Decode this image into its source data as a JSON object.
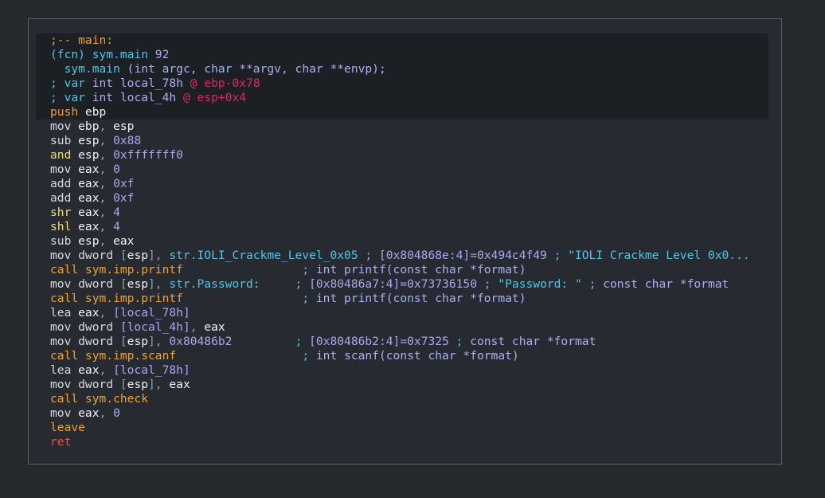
{
  "lines": [
    [
      [
        "c-label",
        ";-- main:"
      ]
    ],
    [
      [
        "c-fcn",
        "(fcn) sym.main"
      ],
      [
        "c-num",
        " 92"
      ]
    ],
    [
      [
        "c-default",
        "  "
      ],
      [
        "c-fcn",
        "sym.main"
      ],
      [
        "c-sig",
        " (int argc, char **argv, char **envp);"
      ]
    ],
    [
      [
        "c-comment",
        "; "
      ],
      [
        "c-comment",
        "var"
      ],
      [
        "c-var",
        " int local_78h "
      ],
      [
        "c-at",
        "@"
      ],
      [
        "c-stack",
        " ebp-0x78"
      ]
    ],
    [
      [
        "c-comment",
        "; "
      ],
      [
        "c-comment",
        "var"
      ],
      [
        "c-var",
        " int local_4h "
      ],
      [
        "c-at",
        "@"
      ],
      [
        "c-stack",
        " esp+0x4"
      ]
    ],
    [
      [
        "c-push",
        "push"
      ],
      [
        "c-reg",
        " ebp"
      ]
    ],
    [
      [
        "c-mov",
        "mov"
      ],
      [
        "c-reg",
        " ebp"
      ],
      [
        "c-punct",
        ","
      ],
      [
        "c-reg",
        " esp"
      ]
    ],
    [
      [
        "c-mov",
        "sub"
      ],
      [
        "c-reg",
        " esp"
      ],
      [
        "c-punct",
        ","
      ],
      [
        "c-num",
        " 0x88"
      ]
    ],
    [
      [
        "c-and",
        "and"
      ],
      [
        "c-reg",
        " esp"
      ],
      [
        "c-punct",
        ","
      ],
      [
        "c-num",
        " 0xfffffff0"
      ]
    ],
    [
      [
        "c-mov",
        "mov"
      ],
      [
        "c-reg",
        " eax"
      ],
      [
        "c-punct",
        ","
      ],
      [
        "c-num",
        " 0"
      ]
    ],
    [
      [
        "c-mov",
        "add"
      ],
      [
        "c-reg",
        " eax"
      ],
      [
        "c-punct",
        ","
      ],
      [
        "c-num",
        " 0xf"
      ]
    ],
    [
      [
        "c-mov",
        "add"
      ],
      [
        "c-reg",
        " eax"
      ],
      [
        "c-punct",
        ","
      ],
      [
        "c-num",
        " 0xf"
      ]
    ],
    [
      [
        "c-shift",
        "shr"
      ],
      [
        "c-reg",
        " eax"
      ],
      [
        "c-punct",
        ","
      ],
      [
        "c-num",
        " 4"
      ]
    ],
    [
      [
        "c-shift",
        "shl"
      ],
      [
        "c-reg",
        " eax"
      ],
      [
        "c-punct",
        ","
      ],
      [
        "c-num",
        " 4"
      ]
    ],
    [
      [
        "c-mov",
        "sub"
      ],
      [
        "c-reg",
        " esp"
      ],
      [
        "c-punct",
        ","
      ],
      [
        "c-reg",
        " eax"
      ]
    ],
    [
      [
        "c-mov",
        "mov dword"
      ],
      [
        "c-punct",
        " ["
      ],
      [
        "c-reg",
        "esp"
      ],
      [
        "c-punct",
        "], "
      ],
      [
        "c-str",
        "str.IOLI_Crackme_Level_0x05"
      ],
      [
        "c-comment",
        " ; "
      ],
      [
        "c-memo",
        "[0x804868e:4]=0x494c4f49"
      ],
      [
        "c-comment",
        " ; "
      ],
      [
        "c-str",
        "\"IOLI Crackme Level 0x0..."
      ]
    ],
    [
      [
        "c-call",
        "call sym.imp.printf"
      ],
      [
        "c-default",
        "                 "
      ],
      [
        "c-comment",
        "; "
      ],
      [
        "c-sig",
        "int printf(const char *format)"
      ]
    ],
    [
      [
        "c-mov",
        "mov dword"
      ],
      [
        "c-punct",
        " ["
      ],
      [
        "c-reg",
        "esp"
      ],
      [
        "c-punct",
        "], "
      ],
      [
        "c-str",
        "str.Password:"
      ],
      [
        "c-default",
        "     "
      ],
      [
        "c-comment",
        "; "
      ],
      [
        "c-memo",
        "[0x80486a7:4]=0x73736150"
      ],
      [
        "c-comment",
        " ; "
      ],
      [
        "c-str",
        "\"Password: \""
      ],
      [
        "c-comment",
        " ; "
      ],
      [
        "c-sig",
        "const char *format"
      ]
    ],
    [
      [
        "c-call",
        "call sym.imp.printf"
      ],
      [
        "c-default",
        "                 "
      ],
      [
        "c-comment",
        "; "
      ],
      [
        "c-sig",
        "int printf(const char *format)"
      ]
    ],
    [
      [
        "c-mov",
        "lea"
      ],
      [
        "c-reg",
        " eax"
      ],
      [
        "c-punct",
        ", "
      ],
      [
        "c-memo",
        "[local_78h]"
      ]
    ],
    [
      [
        "c-mov",
        "mov dword"
      ],
      [
        "c-memo",
        " [local_4h]"
      ],
      [
        "c-punct",
        ","
      ],
      [
        "c-reg",
        " eax"
      ]
    ],
    [
      [
        "c-mov",
        "mov dword"
      ],
      [
        "c-punct",
        " ["
      ],
      [
        "c-reg",
        "esp"
      ],
      [
        "c-punct",
        "], "
      ],
      [
        "c-num",
        "0x80486b2"
      ],
      [
        "c-default",
        "         "
      ],
      [
        "c-comment",
        "; "
      ],
      [
        "c-memo",
        "[0x80486b2:4]=0x7325"
      ],
      [
        "c-comment",
        " ; "
      ],
      [
        "c-sig",
        "const char *format"
      ]
    ],
    [
      [
        "c-call",
        "call sym.imp.scanf"
      ],
      [
        "c-default",
        "                  "
      ],
      [
        "c-comment",
        "; "
      ],
      [
        "c-sig",
        "int scanf(const char *format)"
      ]
    ],
    [
      [
        "c-mov",
        "lea"
      ],
      [
        "c-reg",
        " eax"
      ],
      [
        "c-punct",
        ", "
      ],
      [
        "c-memo",
        "[local_78h]"
      ]
    ],
    [
      [
        "c-mov",
        "mov dword"
      ],
      [
        "c-punct",
        " ["
      ],
      [
        "c-reg",
        "esp"
      ],
      [
        "c-punct",
        "],"
      ],
      [
        "c-reg",
        " eax"
      ]
    ],
    [
      [
        "c-call",
        "call sym.check"
      ]
    ],
    [
      [
        "c-mov",
        "mov"
      ],
      [
        "c-reg",
        " eax"
      ],
      [
        "c-punct",
        ","
      ],
      [
        "c-num",
        " 0"
      ]
    ],
    [
      [
        "c-leave",
        "leave"
      ]
    ],
    [
      [
        "c-ret",
        "ret"
      ]
    ]
  ]
}
